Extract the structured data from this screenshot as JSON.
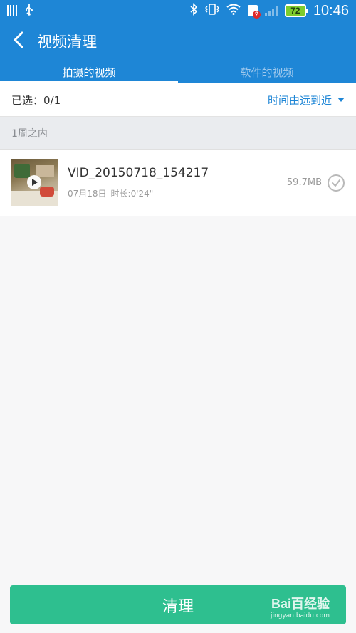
{
  "status_bar": {
    "time": "10:46",
    "battery": "72",
    "icons": [
      "sim-icon",
      "usb-icon",
      "bluetooth-icon",
      "vibrate-icon",
      "wifi-icon",
      "alert-icon",
      "signal-icon",
      "battery-icon"
    ]
  },
  "header": {
    "title": "视频清理",
    "back_icon": "back-arrow-icon"
  },
  "tabs": [
    {
      "label": "拍摄的视频",
      "active": true
    },
    {
      "label": "软件的视频",
      "active": false
    }
  ],
  "selection": {
    "count_text": "已选：0/1",
    "sort_label": "时间由远到近"
  },
  "section": {
    "title": "1周之内"
  },
  "videos": [
    {
      "name": "VID_20150718_154217",
      "date": "07月18日",
      "duration": "时长:0'24\"",
      "size": "59.7MB",
      "checked": false
    }
  ],
  "footer": {
    "clean_label": "清理"
  },
  "watermark": {
    "logo": "Bai百经验",
    "url": "jingyan.baidu.com"
  },
  "colors": {
    "primary": "#1e86d6",
    "accent_green": "#2ebf8f",
    "background": "#f7f7f8"
  }
}
